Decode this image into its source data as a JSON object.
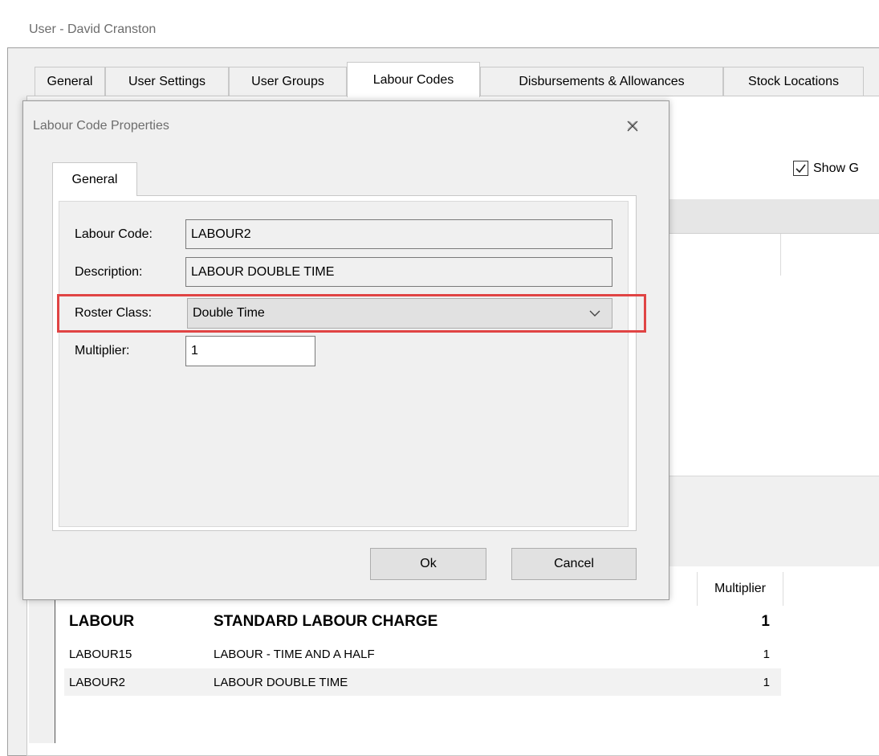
{
  "window": {
    "title": "User - David Cranston"
  },
  "tabs": [
    {
      "label": "General"
    },
    {
      "label": "User Settings"
    },
    {
      "label": "User Groups"
    },
    {
      "label": "Labour Codes"
    },
    {
      "label": "Disbursements & Allowances"
    },
    {
      "label": "Stock Locations"
    }
  ],
  "background": {
    "show_checkbox_label": "Show G",
    "multiplier_header": "Multiplier",
    "rows": [
      {
        "code": "LABOUR",
        "description": "STANDARD LABOUR CHARGE",
        "multiplier": "1"
      },
      {
        "code": "LABOUR15",
        "description": "LABOUR - TIME AND A HALF",
        "multiplier": "1"
      },
      {
        "code": "LABOUR2",
        "description": "LABOUR DOUBLE TIME",
        "multiplier": "1"
      }
    ]
  },
  "dialog": {
    "title": "Labour Code Properties",
    "tab_label": "General",
    "fields": {
      "labour_code": {
        "label": "Labour Code:",
        "value": "LABOUR2"
      },
      "description": {
        "label": "Description:",
        "value": "LABOUR DOUBLE TIME"
      },
      "roster_class": {
        "label": "Roster Class:",
        "value": "Double Time"
      },
      "multiplier": {
        "label": "Multiplier:",
        "value": "1"
      }
    },
    "ok_label": "Ok",
    "cancel_label": "Cancel"
  },
  "colors": {
    "highlight": "#e04444",
    "window_bg": "#f0f0f0"
  },
  "icons": {
    "close": "close-icon",
    "chevron": "chevron-down-icon",
    "checkbox": "checkbox-checked-icon"
  }
}
